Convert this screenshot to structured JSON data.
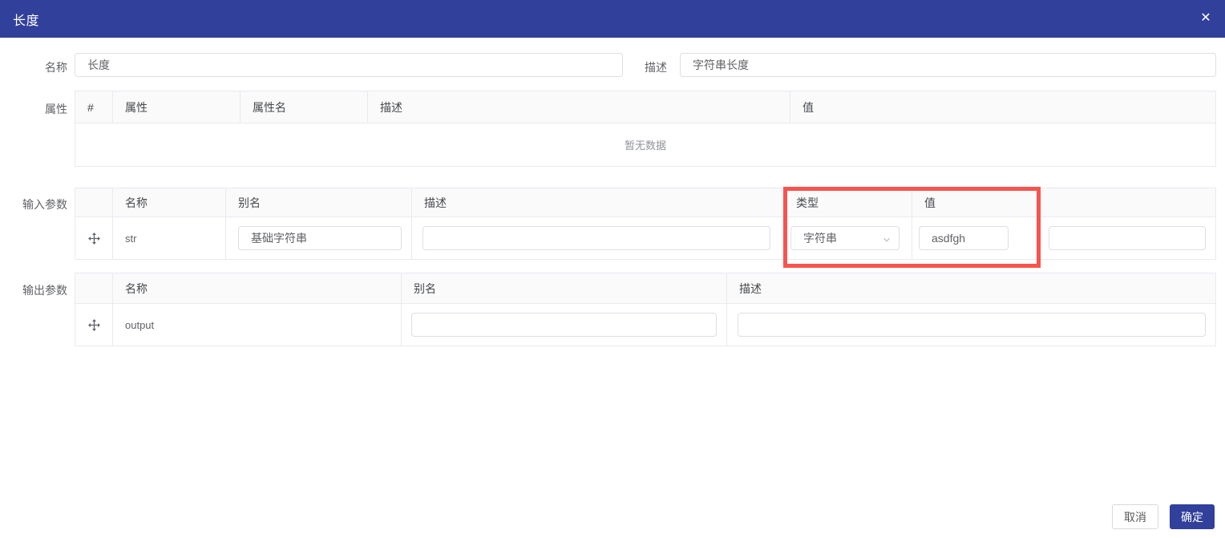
{
  "modal": {
    "title": "长度",
    "close_icon": "✕"
  },
  "form": {
    "name_label": "名称",
    "name_value": "长度",
    "desc_label": "描述",
    "desc_value": "字符串长度"
  },
  "attributes": {
    "label": "属性",
    "columns": [
      "#",
      "属性",
      "属性名",
      "描述",
      "值"
    ],
    "empty_text": "暂无数据"
  },
  "input_params": {
    "label": "输入参数",
    "columns": [
      "名称",
      "别名",
      "描述",
      "类型",
      "值"
    ],
    "row": {
      "name": "str",
      "alias": "基础字符串",
      "desc": "",
      "type": "字符串",
      "value": "asdfgh",
      "extra": ""
    }
  },
  "output_params": {
    "label": "输出参数",
    "columns": [
      "名称",
      "别名",
      "描述"
    ],
    "row": {
      "name": "output",
      "alias": "",
      "desc": ""
    }
  },
  "footer": {
    "cancel_label": "取消",
    "confirm_label": "确定"
  },
  "colors": {
    "primary": "#31409b",
    "highlight_red": "#f8534e",
    "table_header_bg": "#fafafa"
  }
}
